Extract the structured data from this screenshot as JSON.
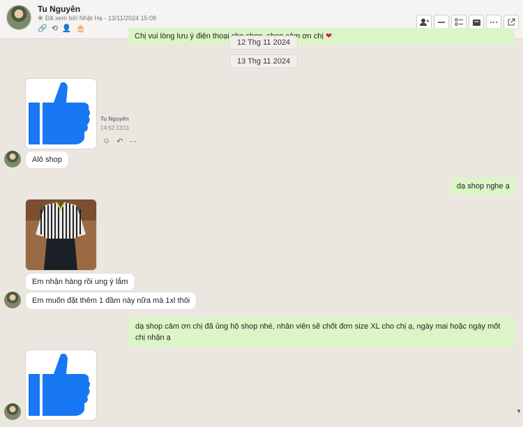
{
  "header": {
    "name": "Tu Nguyên",
    "seen_text": "Đã xem bởi Nhật Hạ - 13/11/2024 15:08"
  },
  "messages": {
    "top_out_partial": "Chị vui lòng lưu ý điện thoại cho shop, shop cảm ơn chị",
    "date1": "12 Thg 11 2024",
    "date2": "13 Thg 11 2024",
    "sender_name": "Tu Nguyên",
    "sender_time": "14:52 13/11",
    "alo": "Alô shop",
    "reply1": "dạ shop nghe ạ",
    "received": "Em nhận hàng rồi ung ý lắm",
    "order_more": "Em muốn đặt thêm 1 đầm này nữa mà 1xl thôi",
    "reply2": "dạ shop cảm ơn chị đã ủng hộ shop nhé, nhân viên sẽ chốt đơn size XL cho chị ạ, ngày mai hoặc ngày mốt chị nhận ạ"
  },
  "colors": {
    "like_blue": "#1877f2",
    "out_bubble": "#dcf5c6",
    "bg": "#ebe7e0"
  }
}
